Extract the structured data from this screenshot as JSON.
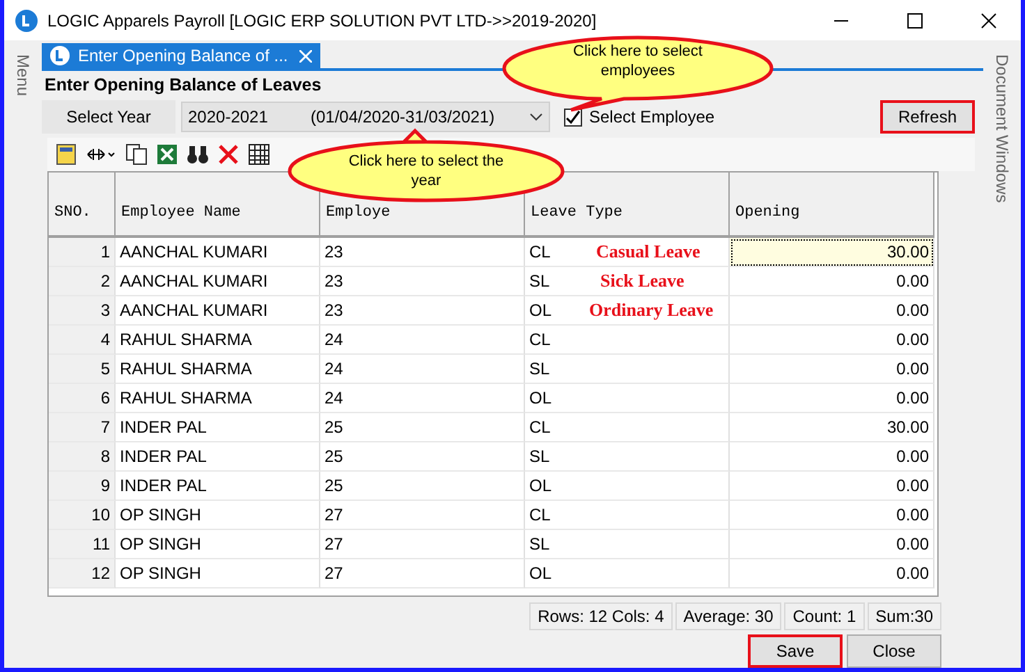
{
  "window": {
    "title": "LOGIC Apparels Payroll  [LOGIC ERP SOLUTION PVT LTD->>2019-2020]"
  },
  "left_dock": {
    "label": "Menu"
  },
  "right_dock": {
    "label": "Document Windows"
  },
  "tab": {
    "label": "Enter Opening Balance of ...",
    "selected": true
  },
  "heading": "Enter Opening Balance of Leaves",
  "year": {
    "label": "Select Year",
    "value": "2020-2021",
    "range": "(01/04/2020-31/03/2021)"
  },
  "select_employee": {
    "label": "Select Employee",
    "checked": true
  },
  "refresh": {
    "label": "Refresh",
    "highlighted": true
  },
  "callouts": [
    {
      "kind": "top",
      "text": "Click  here  to  select employees"
    },
    {
      "kind": "bottom",
      "text": "Click  here  to  select  the year"
    }
  ],
  "table": {
    "columns": [
      "SNO.",
      "Employee Name",
      "Employe",
      "Leave Type",
      "Opening"
    ],
    "rows": [
      {
        "sno": "1",
        "name": "AANCHAL KUMARI",
        "code": "23",
        "type": "CL",
        "opening": "30.00",
        "selected": true,
        "note": "Casual Leave"
      },
      {
        "sno": "2",
        "name": "AANCHAL KUMARI",
        "code": "23",
        "type": "SL",
        "opening": "0.00",
        "selected": false,
        "note": "Sick Leave"
      },
      {
        "sno": "3",
        "name": "AANCHAL KUMARI",
        "code": "23",
        "type": "OL",
        "opening": "0.00",
        "selected": false,
        "note": "Ordinary Leave"
      },
      {
        "sno": "4",
        "name": "RAHUL SHARMA",
        "code": "24",
        "type": "CL",
        "opening": "0.00",
        "selected": false
      },
      {
        "sno": "5",
        "name": "RAHUL SHARMA",
        "code": "24",
        "type": "SL",
        "opening": "0.00",
        "selected": false
      },
      {
        "sno": "6",
        "name": "RAHUL SHARMA",
        "code": "24",
        "type": "OL",
        "opening": "0.00",
        "selected": false
      },
      {
        "sno": "7",
        "name": "INDER PAL",
        "code": "25",
        "type": "CL",
        "opening": "30.00",
        "selected": false
      },
      {
        "sno": "8",
        "name": "INDER PAL",
        "code": "25",
        "type": "SL",
        "opening": "0.00",
        "selected": false
      },
      {
        "sno": "9",
        "name": "INDER PAL",
        "code": "25",
        "type": "OL",
        "opening": "0.00",
        "selected": false
      },
      {
        "sno": "10",
        "name": "OP SINGH",
        "code": "27",
        "type": "CL",
        "opening": "0.00",
        "selected": false
      },
      {
        "sno": "11",
        "name": "OP SINGH",
        "code": "27",
        "type": "SL",
        "opening": "0.00",
        "selected": false
      },
      {
        "sno": "12",
        "name": "OP SINGH",
        "code": "27",
        "type": "OL",
        "opening": "0.00",
        "selected": false
      }
    ]
  },
  "status_bar": [
    "Rows: 12  Cols: 4",
    "Average: 30",
    "Count: 1",
    "Sum:30"
  ],
  "buttons": [
    {
      "label": "Save",
      "highlighted": true
    },
    {
      "label": "Close",
      "highlighted": false
    }
  ]
}
